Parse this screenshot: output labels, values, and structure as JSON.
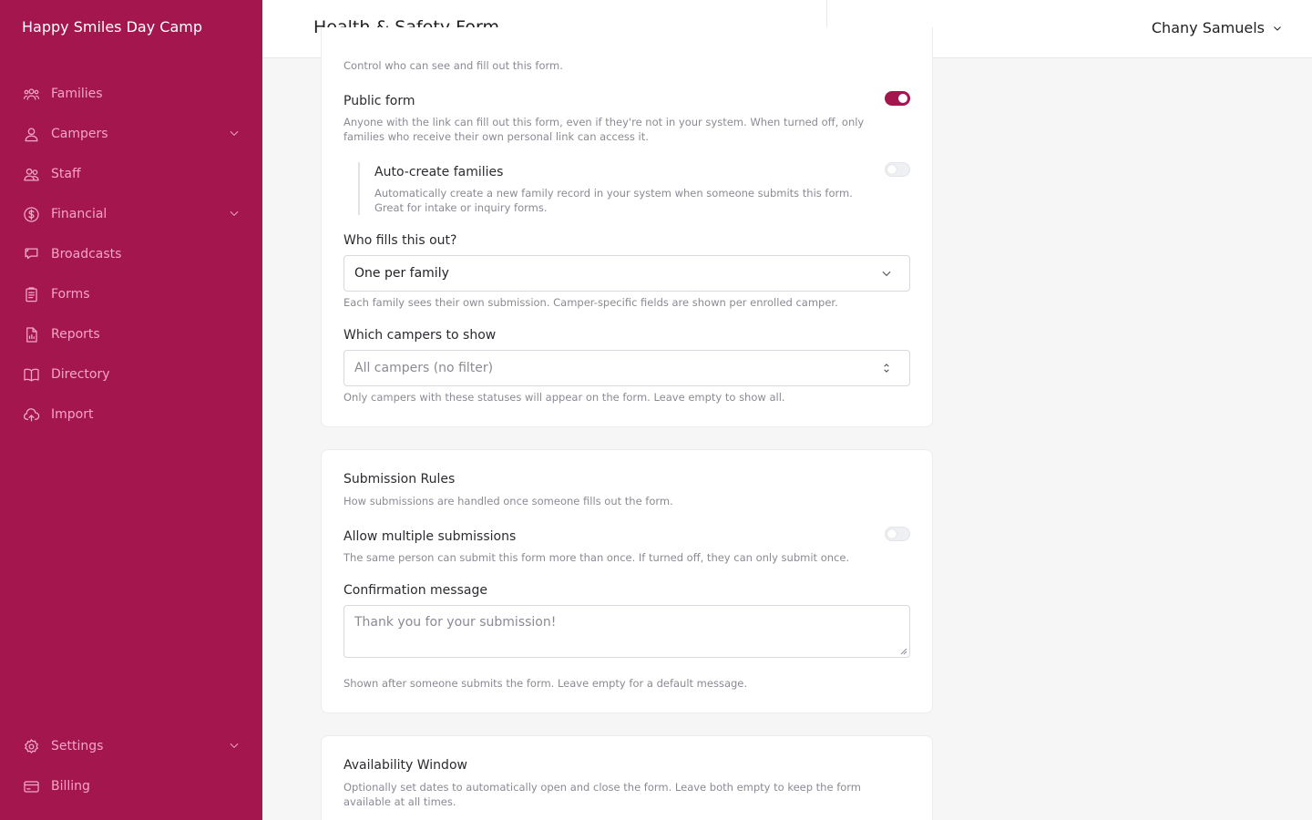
{
  "app": {
    "name": "Happy Smiles Day Camp"
  },
  "sidebar": {
    "items": [
      {
        "label": "Families",
        "icon": "users-icon",
        "has_chevron": false
      },
      {
        "label": "Campers",
        "icon": "user-icon",
        "has_chevron": true
      },
      {
        "label": "Staff",
        "icon": "staff-icon",
        "has_chevron": false
      },
      {
        "label": "Financial",
        "icon": "dollar-icon",
        "has_chevron": true
      },
      {
        "label": "Broadcasts",
        "icon": "chat-icon",
        "has_chevron": false
      },
      {
        "label": "Forms",
        "icon": "clipboard-icon",
        "has_chevron": false
      },
      {
        "label": "Reports",
        "icon": "report-icon",
        "has_chevron": false
      },
      {
        "label": "Directory",
        "icon": "book-icon",
        "has_chevron": false
      },
      {
        "label": "Import",
        "icon": "cloud-upload-icon",
        "has_chevron": false
      }
    ],
    "bottom_items": [
      {
        "label": "Settings",
        "icon": "gear-icon",
        "has_chevron": true
      },
      {
        "label": "Billing",
        "icon": "credit-card-icon",
        "has_chevron": false
      }
    ]
  },
  "header": {
    "title": "Health & Safety Form",
    "user_name": "Chany Samuels"
  },
  "access": {
    "description": "Control who can see and fill out this form.",
    "public_form": {
      "label": "Public form",
      "enabled": true,
      "description": "Anyone with the link can fill out this form, even if they're not in your system. When turned off, only families who receive their own personal link can access it."
    },
    "auto_create": {
      "label": "Auto-create families",
      "enabled": false,
      "description": "Automatically create a new family record in your system when someone submits this form. Great for intake or inquiry forms."
    },
    "who_fills": {
      "label": "Who fills this out?",
      "value": "One per family",
      "help": "Each family sees their own submission. Camper-specific fields are shown per enrolled camper."
    },
    "which_campers": {
      "label": "Which campers to show",
      "placeholder": "All campers (no filter)",
      "help": "Only campers with these statuses will appear on the form. Leave empty to show all."
    }
  },
  "submission_rules": {
    "title": "Submission Rules",
    "description": "How submissions are handled once someone fills out the form.",
    "multiple": {
      "label": "Allow multiple submissions",
      "enabled": false,
      "description": "The same person can submit this form more than once. If turned off, they can only submit once."
    },
    "confirmation": {
      "label": "Confirmation message",
      "placeholder": "Thank you for your submission!",
      "help": "Shown after someone submits the form. Leave empty for a default message."
    }
  },
  "availability": {
    "title": "Availability Window",
    "description": "Optionally set dates to automatically open and close the form. Leave both empty to keep the form available at all times."
  },
  "colors": {
    "brand": "#a3164e",
    "nav_text": "#f7a6c4"
  }
}
